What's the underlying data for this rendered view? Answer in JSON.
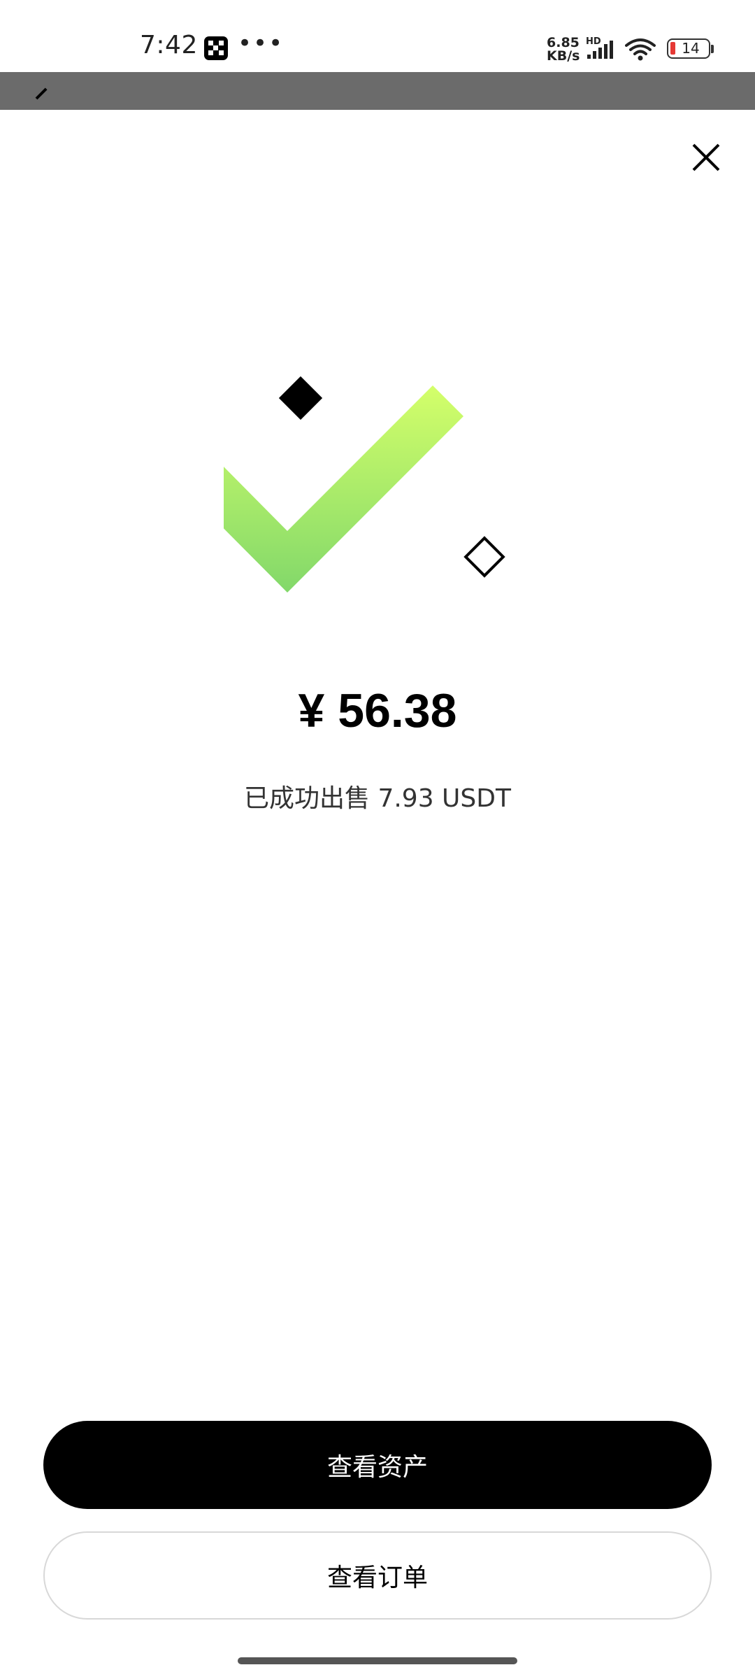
{
  "status_bar": {
    "time": "7:42",
    "dots": "•••",
    "net_speed_value": "6.85",
    "net_speed_unit": "KB/s",
    "hd_label": "HD",
    "battery_level": "14"
  },
  "sheet": {
    "amount": "¥ 56.38",
    "sold_text": "已成功出售 7.93 USDT",
    "primary_button": "查看资产",
    "secondary_button": "查看订单"
  },
  "colors": {
    "check_top": "#d4ff6a",
    "check_bottom": "#82d86a",
    "primary_bg": "#000000",
    "battery_low": "#e53935"
  },
  "icons": {
    "close": "close-icon",
    "success": "checkmark-icon",
    "app": "okx-app-icon",
    "wifi": "wifi-icon",
    "signal": "signal-icon",
    "battery": "battery-icon"
  }
}
